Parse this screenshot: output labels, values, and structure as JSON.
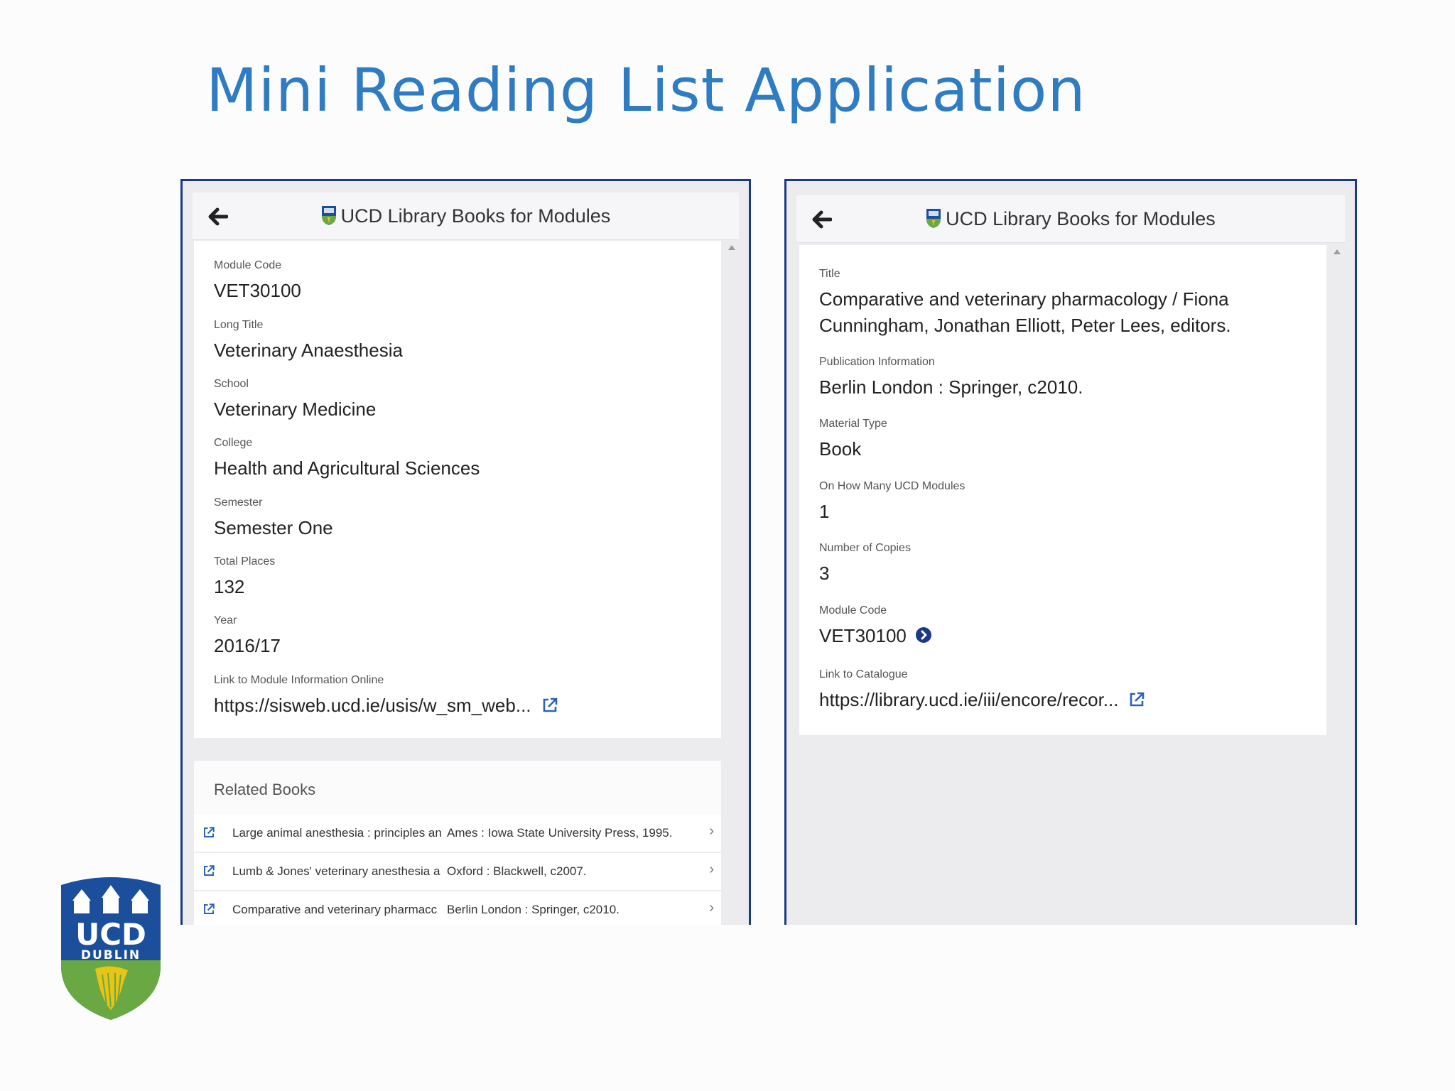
{
  "slide": {
    "title": "Mini Reading List Application"
  },
  "logo": {
    "line1": "UCD",
    "line2": "DUBLIN"
  },
  "left_screen": {
    "appbar": {
      "title": "UCD Library Books for Modules",
      "back_icon": "arrow-left-icon"
    },
    "fields": [
      {
        "label": "Module Code",
        "value": "VET30100"
      },
      {
        "label": "Long Title",
        "value": "Veterinary Anaesthesia"
      },
      {
        "label": "School",
        "value": "Veterinary Medicine"
      },
      {
        "label": "College",
        "value": "Health and Agricultural Sciences"
      },
      {
        "label": "Semester",
        "value": "Semester One"
      },
      {
        "label": "Total Places",
        "value": "132"
      },
      {
        "label": "Year",
        "value": "2016/17"
      },
      {
        "label": "Link to Module Information Online",
        "value": "https://sisweb.ucd.ie/usis/w_sm_web..."
      }
    ],
    "related": {
      "header": "Related Books",
      "items": [
        {
          "title": "Large animal anesthesia : principles an",
          "publication": "Ames : Iowa State University Press, 1995."
        },
        {
          "title": "Lumb & Jones' veterinary anesthesia a",
          "publication": "Oxford : Blackwell, c2007."
        },
        {
          "title": "Comparative and veterinary pharmacc",
          "publication": "Berlin London : Springer, c2010."
        }
      ]
    }
  },
  "right_screen": {
    "appbar": {
      "title": "UCD Library Books for Modules",
      "back_icon": "arrow-left-icon"
    },
    "fields": [
      {
        "label": "Title",
        "value": "Comparative and veterinary pharmacology / Fiona Cunningham, Jonathan Elliott, Peter Lees, editors."
      },
      {
        "label": "Publication Information",
        "value": "Berlin  London : Springer, c2010."
      },
      {
        "label": "Material Type",
        "value": "Book"
      },
      {
        "label": "On How Many UCD Modules",
        "value": "1"
      },
      {
        "label": "Number of Copies",
        "value": "3"
      },
      {
        "label": "Module Code",
        "value": "VET30100"
      },
      {
        "label": "Link to Catalogue",
        "value": "https://library.ucd.ie/iii/encore/recor..."
      }
    ]
  },
  "colors": {
    "title_blue": "#2f7cc2",
    "frame_navy": "#1b3a86",
    "ucd_blue": "#1b4f9c",
    "ucd_green": "#6aa843",
    "ucd_yellow": "#e8c417"
  }
}
